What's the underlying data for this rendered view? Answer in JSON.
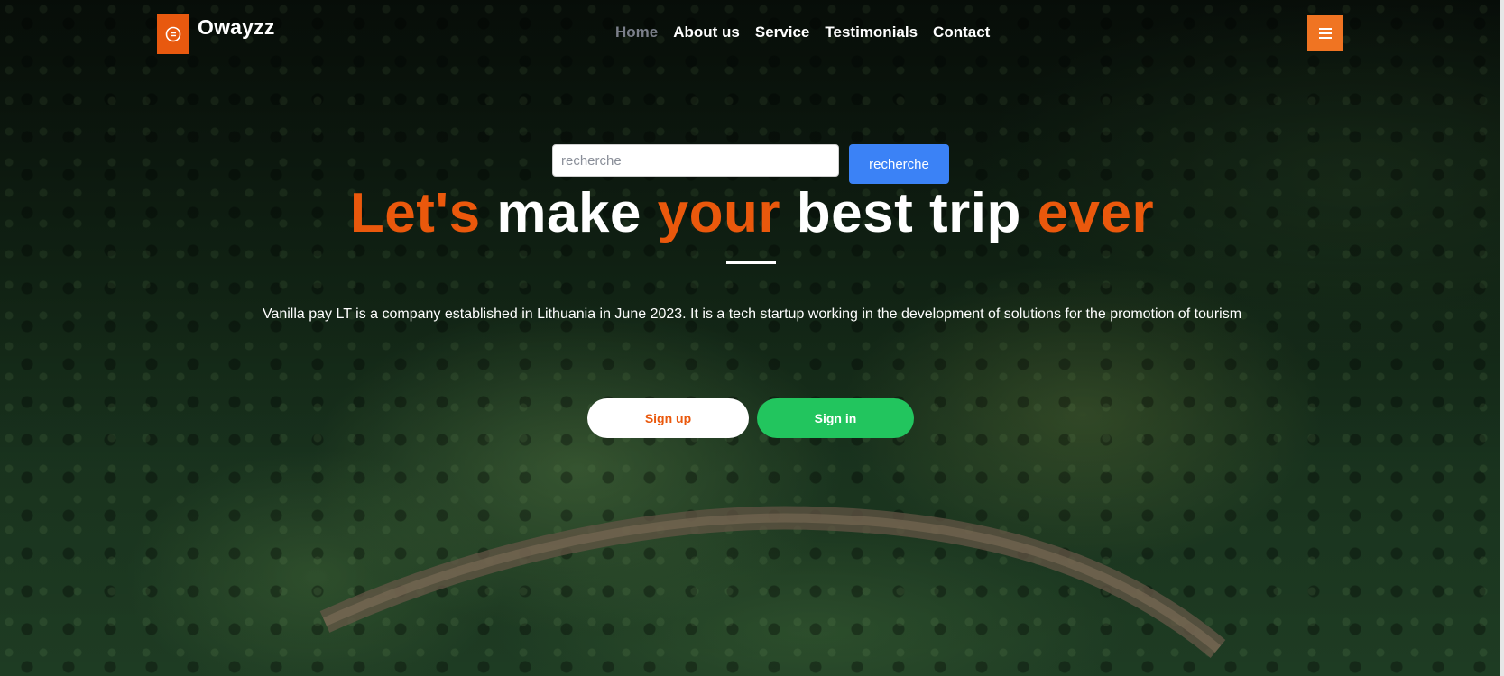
{
  "header": {
    "brand_name": "Owayzz",
    "nav": [
      {
        "label": "Home",
        "active": true
      },
      {
        "label": "About us",
        "active": false
      },
      {
        "label": "Service",
        "active": false
      },
      {
        "label": "Testimonials",
        "active": false
      },
      {
        "label": "Contact",
        "active": false
      }
    ],
    "menu_icon": "hamburger-icon"
  },
  "search": {
    "placeholder": "recherche",
    "value": "",
    "button_label": "recherche"
  },
  "hero": {
    "headline_words": [
      {
        "text": "Let's",
        "accent": true
      },
      {
        "text": "make",
        "accent": false
      },
      {
        "text": "your",
        "accent": true
      },
      {
        "text": "best trip",
        "accent": false
      },
      {
        "text": "ever",
        "accent": true
      }
    ],
    "tagline": "Vanilla pay LT is a company established in Lithuania in June 2023. It is a tech startup working in the development of solutions for the promotion of tourism",
    "signup_label": "Sign up",
    "signin_label": "Sign in"
  },
  "colors": {
    "accent": "#ea580c",
    "search_button": "#3b82f6",
    "signin_button": "#22c55e"
  }
}
